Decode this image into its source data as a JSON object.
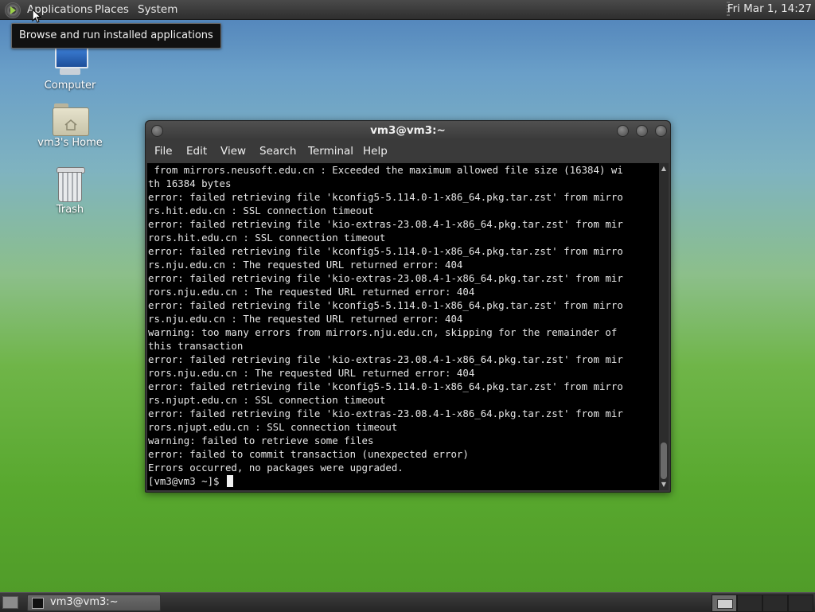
{
  "top_panel": {
    "menus": [
      "Applications",
      "Places",
      "System"
    ],
    "clock": "Fri Mar  1, 14:27"
  },
  "tooltip": "Browse and run installed applications",
  "desktop_icons": [
    {
      "label": "Computer",
      "icon": "computer-icon"
    },
    {
      "label": "vm3's Home",
      "icon": "home-folder-icon"
    },
    {
      "label": "Trash",
      "icon": "trash-icon"
    }
  ],
  "terminal": {
    "title": "vm3@vm3:~",
    "menu": [
      "File",
      "Edit",
      "View",
      "Search",
      "Terminal",
      "Help"
    ],
    "lines": [
      " from mirrors.neusoft.edu.cn : Exceeded the maximum allowed file size (16384) wi",
      "th 16384 bytes",
      "error: failed retrieving file 'kconfig5-5.114.0-1-x86_64.pkg.tar.zst' from mirro",
      "rs.hit.edu.cn : SSL connection timeout",
      "error: failed retrieving file 'kio-extras-23.08.4-1-x86_64.pkg.tar.zst' from mir",
      "rors.hit.edu.cn : SSL connection timeout",
      "error: failed retrieving file 'kconfig5-5.114.0-1-x86_64.pkg.tar.zst' from mirro",
      "rs.nju.edu.cn : The requested URL returned error: 404",
      "error: failed retrieving file 'kio-extras-23.08.4-1-x86_64.pkg.tar.zst' from mir",
      "rors.nju.edu.cn : The requested URL returned error: 404",
      "error: failed retrieving file 'kconfig5-5.114.0-1-x86_64.pkg.tar.zst' from mirro",
      "rs.nju.edu.cn : The requested URL returned error: 404",
      "warning: too many errors from mirrors.nju.edu.cn, skipping for the remainder of",
      "this transaction",
      "error: failed retrieving file 'kio-extras-23.08.4-1-x86_64.pkg.tar.zst' from mir",
      "rors.nju.edu.cn : The requested URL returned error: 404",
      "error: failed retrieving file 'kconfig5-5.114.0-1-x86_64.pkg.tar.zst' from mirro",
      "rs.njupt.edu.cn : SSL connection timeout",
      "error: failed retrieving file 'kio-extras-23.08.4-1-x86_64.pkg.tar.zst' from mir",
      "rors.njupt.edu.cn : SSL connection timeout",
      "warning: failed to retrieve some files",
      "error: failed to commit transaction (unexpected error)",
      "Errors occurred, no packages were upgraded."
    ],
    "prompt": "[vm3@vm3 ~]$ "
  },
  "taskbar": {
    "window_button": "vm3@vm3:~"
  }
}
